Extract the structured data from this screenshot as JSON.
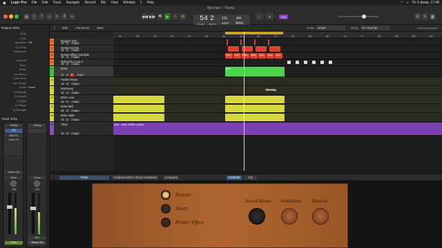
{
  "menubar": {
    "apple": "",
    "app": "Logic Pro",
    "items": [
      "File",
      "Edit",
      "Track",
      "Navigate",
      "Record",
      "Mix",
      "View",
      "Window",
      "1",
      "Help"
    ],
    "status": "Пт 5 февр.  17:48"
  },
  "window": {
    "title": "Мустанг – Tracks"
  },
  "lcd": {
    "bar": "54",
    "beat": "2",
    "tempo": "131",
    "tempo_label": "KEEP",
    "sig": "4/4",
    "key": "Amin",
    "bar_label": "BAR",
    "beat_label": "BEAT"
  },
  "toolbar": {
    "avatar": "n34",
    "snap_label": "Snap:",
    "snap_value": "Smart",
    "drag_label": "Drag:",
    "drag_value": "No Overlap"
  },
  "tracks_header": {
    "edit": "Edit",
    "functions": "Functions",
    "view": "View",
    "add": "+"
  },
  "inspector": {
    "region_header": "Region: Erhu",
    "rows": [
      [
        "Mute",
        ""
      ],
      [
        "Loop",
        ""
      ],
      [
        "Quantize",
        "Off"
      ],
      [
        "Q-Swing",
        ""
      ],
      [
        "Transpose",
        ""
      ],
      [
        "",
        ""
      ],
      [
        "Velocity",
        ""
      ],
      [
        "More",
        ""
      ],
      [
        "Delay",
        ""
      ],
      [
        "Dynamics",
        ""
      ],
      [
        "Gate Time",
        ""
      ],
      [
        "Clip Length",
        ""
      ],
      [
        "Score",
        "Show"
      ],
      [
        "Q-Velocity",
        ""
      ],
      [
        "Q-Length",
        ""
      ],
      [
        "Q-Flam",
        ""
      ],
      [
        "Q-Range",
        ""
      ],
      [
        "Q-Strength",
        ""
      ]
    ],
    "track_header": "Track: Erhu",
    "strip": {
      "setting": "Setting",
      "eq": "EQ",
      "midi_fx": "MIDI FX",
      "instrument": "Audio FX",
      "sends": "Sends",
      "stereo_out": "Stereo Out",
      "group": "Group",
      "read": "Read",
      "value": "-4.8",
      "value2": "0.0",
      "name1": "Erhu",
      "name2": "Stereo Out",
      "bnc": "Bnc"
    }
  },
  "ruler": {
    "ticks": [
      "21",
      "25",
      "29",
      "33",
      "37",
      "41",
      "45",
      "49",
      "53",
      "57",
      "61",
      "65",
      "69",
      "73",
      "77",
      "81",
      "85",
      "89",
      "93"
    ]
  },
  "markers": {
    "label": "Marker",
    "items": [
      "Intro",
      "Verse 1",
      "Chorus 1",
      "Verse 2",
      "Chorus 2",
      "Bridge"
    ]
  },
  "tracks": [
    {
      "num": "1",
      "name": "Engine Tom",
      "color": "#e8762c",
      "h": 10
    },
    {
      "num": "2",
      "name": "Horse Hi-Hat",
      "color": "#e8762c",
      "h": 10
    },
    {
      "num": "3",
      "name": "Horse Effect Sample",
      "color": "#e8762c",
      "h": 10
    },
    {
      "num": "4",
      "name": "Sub Erhu Low A",
      "color": "#e8762c",
      "h": 10
    },
    {
      "num": "5",
      "name": "Erhu",
      "color": "#3fc53f",
      "h": 16
    },
    {
      "num": "6",
      "name": "Faded Keys",
      "color": "#d7d741",
      "h": 13
    },
    {
      "num": "7",
      "name": "Harmony",
      "color": "#d7d741",
      "h": 13
    },
    {
      "num": "8",
      "name": "Erhu Low",
      "color": "#d7d741",
      "h": 13
    },
    {
      "num": "9",
      "name": "Erhu Mid",
      "color": "#d7d741",
      "h": 13
    },
    {
      "num": "10",
      "name": "Erhu High",
      "color": "#d7d741",
      "h": 13
    },
    {
      "num": "11",
      "name": "Vinyl",
      "color": "#8a4ec0",
      "h": 20
    }
  ],
  "track_btn": {
    "m": "M",
    "s": "S",
    "r": "R",
    "track": "Track"
  },
  "regions": {
    "harmony_label": "Harmony",
    "erhu_label": "Erhu",
    "vinyl_label": "vinyl – drop, crackle, pickup",
    "horse_label": "Hors"
  },
  "bottombar": {
    "track": "Track",
    "preset": "Ambience/Erhu Short Ambience",
    "compare": "Compare",
    "controls": "Controls",
    "eq": "EQ"
  },
  "plugin": {
    "sustain": "Sustain",
    "short": "Short",
    "flutter": "Flutter Effect",
    "auto_vibrato": "AutoVibrato",
    "ambience": "Ambience",
    "reverb": "Reverb"
  },
  "colors": {
    "orange": "#e8762c",
    "green": "#3fc53f",
    "yellow": "#d7d741",
    "purple": "#8a4ec0",
    "red": "#d9452c",
    "playhead": "#ffffff"
  }
}
